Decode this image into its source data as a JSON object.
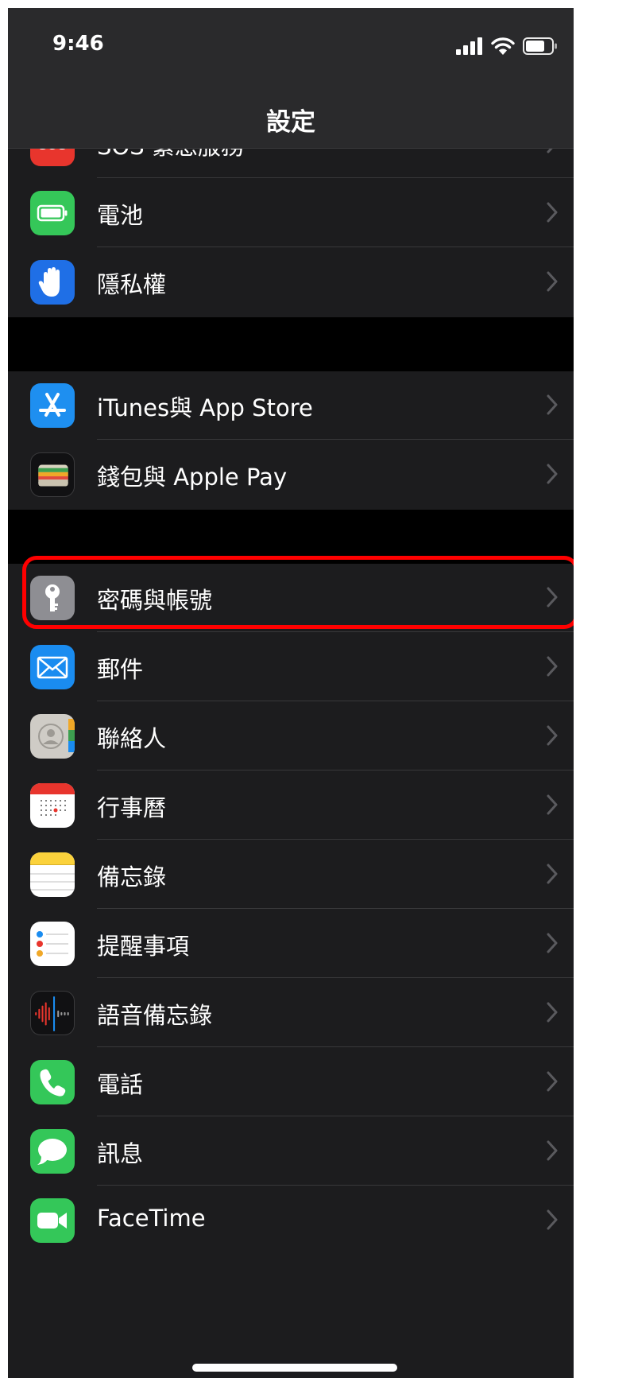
{
  "status": {
    "time": "9:46"
  },
  "nav": {
    "title": "設定"
  },
  "rows": {
    "sos": "SOS 緊急服務",
    "battery": "電池",
    "privacy": "隱私權",
    "itunes": "iTunes與 App Store",
    "wallet": "錢包與 Apple Pay",
    "passwords": "密碼與帳號",
    "mail": "郵件",
    "contacts": "聯絡人",
    "calendar": "行事曆",
    "notes": "備忘錄",
    "reminders": "提醒事項",
    "voicememos": "語音備忘錄",
    "phone": "電話",
    "messages": "訊息",
    "facetime": "FaceTime"
  },
  "icons": {
    "sos": "sos-icon",
    "battery": "battery-icon",
    "privacy": "hand-icon",
    "itunes": "app-store-icon",
    "wallet": "wallet-icon",
    "passwords": "key-icon",
    "mail": "envelope-icon",
    "contacts": "contacts-icon",
    "calendar": "calendar-icon",
    "notes": "notes-icon",
    "reminders": "reminders-icon",
    "voicememos": "waveform-icon",
    "phone": "phone-icon",
    "messages": "speech-bubble-icon",
    "facetime": "video-camera-icon"
  },
  "colors": {
    "background": "#1c1c1e",
    "highlight": "#ff0000",
    "sos": "#e8352d",
    "battery": "#35c759",
    "privacy": "#1f6fe6",
    "itunes": "#1e8ff0",
    "passwords": "#8e8e93",
    "mail": "#1a8cf0",
    "phone": "#34c759",
    "messages": "#34c759",
    "facetime": "#34c759"
  }
}
